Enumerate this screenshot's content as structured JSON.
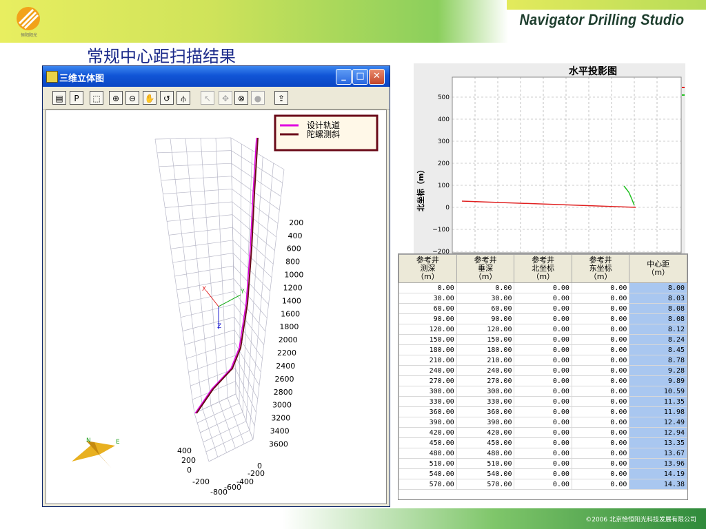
{
  "brand": "Navigator Drilling Studio",
  "logo_text": "恒阳阳光",
  "slide_title": "常规中心距扫描结果",
  "copyright": "©2006  北京恰恒阳光科技发展有限公司",
  "window": {
    "title": "三维立体图",
    "min_label": "_",
    "max_label": "□",
    "close_label": "✕"
  },
  "toolbar": [
    {
      "name": "print-icon",
      "glyph": "▤",
      "disabled": false
    },
    {
      "name": "p-button",
      "glyph": "P",
      "disabled": false
    },
    {
      "name": "frame-icon",
      "glyph": "⬚",
      "disabled": false
    },
    {
      "name": "zoom-in-icon",
      "glyph": "⊕",
      "disabled": false
    },
    {
      "name": "zoom-out-icon",
      "glyph": "⊖",
      "disabled": false
    },
    {
      "name": "pan-hand-icon",
      "glyph": "✋",
      "disabled": false
    },
    {
      "name": "rotate-icon",
      "glyph": "↺",
      "disabled": false
    },
    {
      "name": "axis-icon",
      "glyph": "⫛",
      "disabled": false
    },
    {
      "name": "pointer-disabled-icon",
      "glyph": "↖",
      "disabled": true
    },
    {
      "name": "move-disabled-icon",
      "glyph": "✥",
      "disabled": true
    },
    {
      "name": "target-icon",
      "glyph": "⊗",
      "disabled": false
    },
    {
      "name": "stop-disabled-icon",
      "glyph": "●",
      "disabled": true
    },
    {
      "name": "export-icon",
      "glyph": "⇪",
      "disabled": false
    }
  ],
  "legend": {
    "design": "设计轨道",
    "gyro": "陀螺测斜",
    "design_color": "#e000e0",
    "gyro_color": "#6a0a18"
  },
  "depth_ticks": [
    "200",
    "400",
    "600",
    "800",
    "1000",
    "1200",
    "1400",
    "1600",
    "1800",
    "2000",
    "2200",
    "2400",
    "2600",
    "2800",
    "3000",
    "3200",
    "3400",
    "3600"
  ],
  "axis_labels": {
    "left": [
      "400",
      "200",
      "0"
    ],
    "bottom": [
      "-200",
      "-600",
      "-400",
      "-800"
    ],
    "right": [
      "0",
      "-200"
    ],
    "x": "X",
    "y": "Y",
    "z": "Z"
  },
  "compass": {
    "n": "N",
    "e": "E"
  },
  "plan_chart": {
    "title": "水平投影图",
    "ylabel": "北坐标（m）",
    "yticks": [
      "500",
      "400",
      "300",
      "200",
      "100",
      "0",
      "−100",
      "−200"
    ],
    "red_line": "#e02020",
    "green_line": "#20c020"
  },
  "table": {
    "headers": [
      [
        "参考井",
        "测深",
        "（m）"
      ],
      [
        "参考井",
        "垂深",
        "（m）"
      ],
      [
        "参考井",
        "北坐标",
        "（m）"
      ],
      [
        "参考井",
        "东坐标",
        "（m）"
      ],
      [
        "中心距",
        "（m）"
      ]
    ],
    "rows": [
      [
        "0.00",
        "0.00",
        "0.00",
        "0.00",
        "8.00"
      ],
      [
        "30.00",
        "30.00",
        "0.00",
        "0.00",
        "8.03"
      ],
      [
        "60.00",
        "60.00",
        "0.00",
        "0.00",
        "8.08"
      ],
      [
        "90.00",
        "90.00",
        "0.00",
        "0.00",
        "8.08"
      ],
      [
        "120.00",
        "120.00",
        "0.00",
        "0.00",
        "8.12"
      ],
      [
        "150.00",
        "150.00",
        "0.00",
        "0.00",
        "8.24"
      ],
      [
        "180.00",
        "180.00",
        "0.00",
        "0.00",
        "8.45"
      ],
      [
        "210.00",
        "210.00",
        "0.00",
        "0.00",
        "8.78"
      ],
      [
        "240.00",
        "240.00",
        "0.00",
        "0.00",
        "9.28"
      ],
      [
        "270.00",
        "270.00",
        "0.00",
        "0.00",
        "9.89"
      ],
      [
        "300.00",
        "300.00",
        "0.00",
        "0.00",
        "10.59"
      ],
      [
        "330.00",
        "330.00",
        "0.00",
        "0.00",
        "11.35"
      ],
      [
        "360.00",
        "360.00",
        "0.00",
        "0.00",
        "11.98"
      ],
      [
        "390.00",
        "390.00",
        "0.00",
        "0.00",
        "12.49"
      ],
      [
        "420.00",
        "420.00",
        "0.00",
        "0.00",
        "12.94"
      ],
      [
        "450.00",
        "450.00",
        "0.00",
        "0.00",
        "13.35"
      ],
      [
        "480.00",
        "480.00",
        "0.00",
        "0.00",
        "13.67"
      ],
      [
        "510.00",
        "510.00",
        "0.00",
        "0.00",
        "13.96"
      ],
      [
        "540.00",
        "540.00",
        "0.00",
        "0.00",
        "14.19"
      ],
      [
        "570.00",
        "570.00",
        "0.00",
        "0.00",
        "14.38"
      ]
    ]
  }
}
